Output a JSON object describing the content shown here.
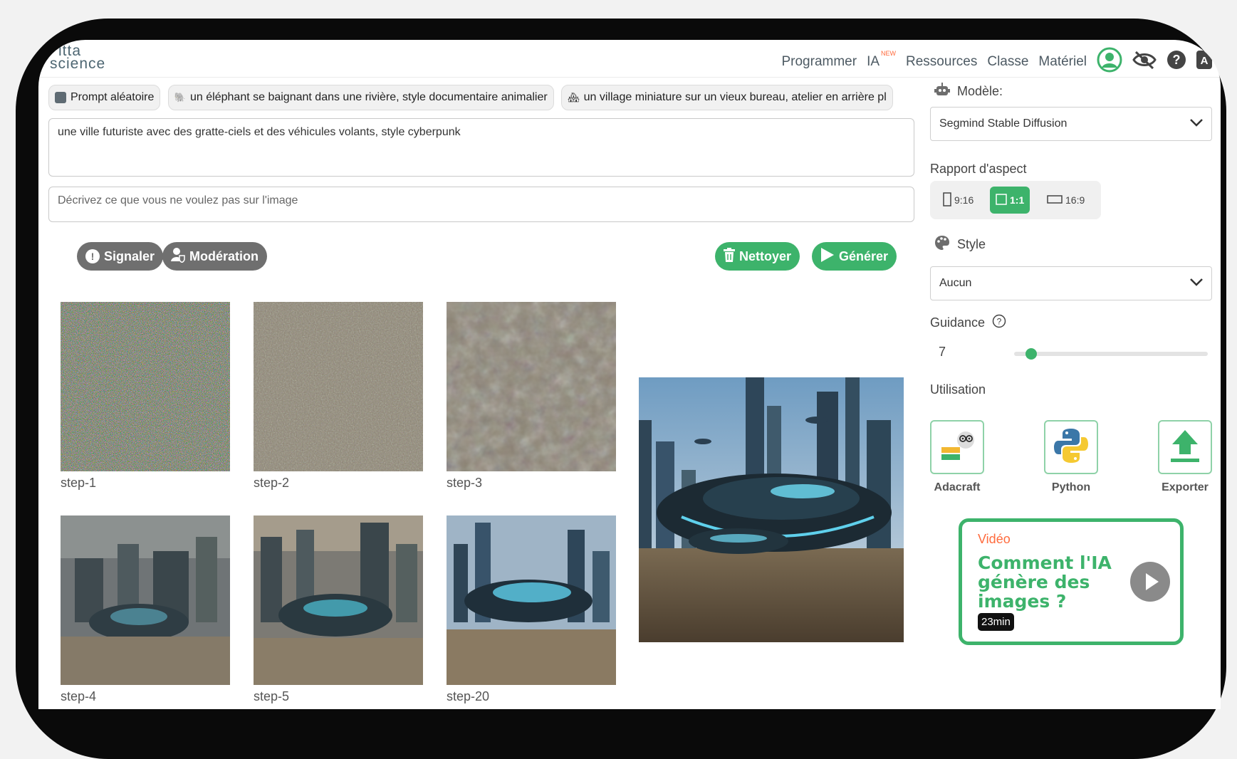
{
  "brand": {
    "line1": "itta",
    "line2": "science"
  },
  "nav": {
    "items": [
      "Programmer",
      "IA",
      "Ressources",
      "Classe",
      "Matériel"
    ],
    "ia_badge": "NEW"
  },
  "prompts": {
    "chips": [
      {
        "label": "Prompt aléatoire",
        "icon": "dice-icon"
      },
      {
        "label": "un éléphant se baignant dans une rivière, style documentaire animalier",
        "icon": "elephant-emoji"
      },
      {
        "label": "un village miniature sur un vieux bureau, atelier en arrière pl",
        "icon": "village-emoji"
      }
    ],
    "prompt_value": "une ville futuriste avec des gratte-ciels et des véhicules volants, style cyberpunk",
    "negative_placeholder": "Décrivez ce que vous ne voulez pas sur l'image"
  },
  "actions": {
    "report": "Signaler",
    "moderation": "Modération",
    "clean": "Nettoyer",
    "generate": "Générer"
  },
  "gallery": {
    "steps": [
      "step-1",
      "step-2",
      "step-3",
      "step-4",
      "step-5",
      "step-20"
    ]
  },
  "panel": {
    "model_label": "Modèle:",
    "model_value": "Segmind Stable Diffusion",
    "aspect_label": "Rapport d'aspect",
    "aspect_options": [
      "9:16",
      "1:1",
      "16:9"
    ],
    "aspect_selected": "1:1",
    "style_label": "Style",
    "style_value": "Aucun",
    "guidance_label": "Guidance",
    "guidance_value": "7",
    "guidance_fraction": 0.06,
    "usage_label": "Utilisation",
    "usage": [
      "Adacraft",
      "Python",
      "Exporter"
    ]
  },
  "video": {
    "tag": "Vidéo",
    "title": "Comment l'IA génère des images ?",
    "duration": "23min"
  },
  "colors": {
    "accent": "#3db36b",
    "orange": "#ff6b3d",
    "grey_button": "#6f6f6f"
  }
}
